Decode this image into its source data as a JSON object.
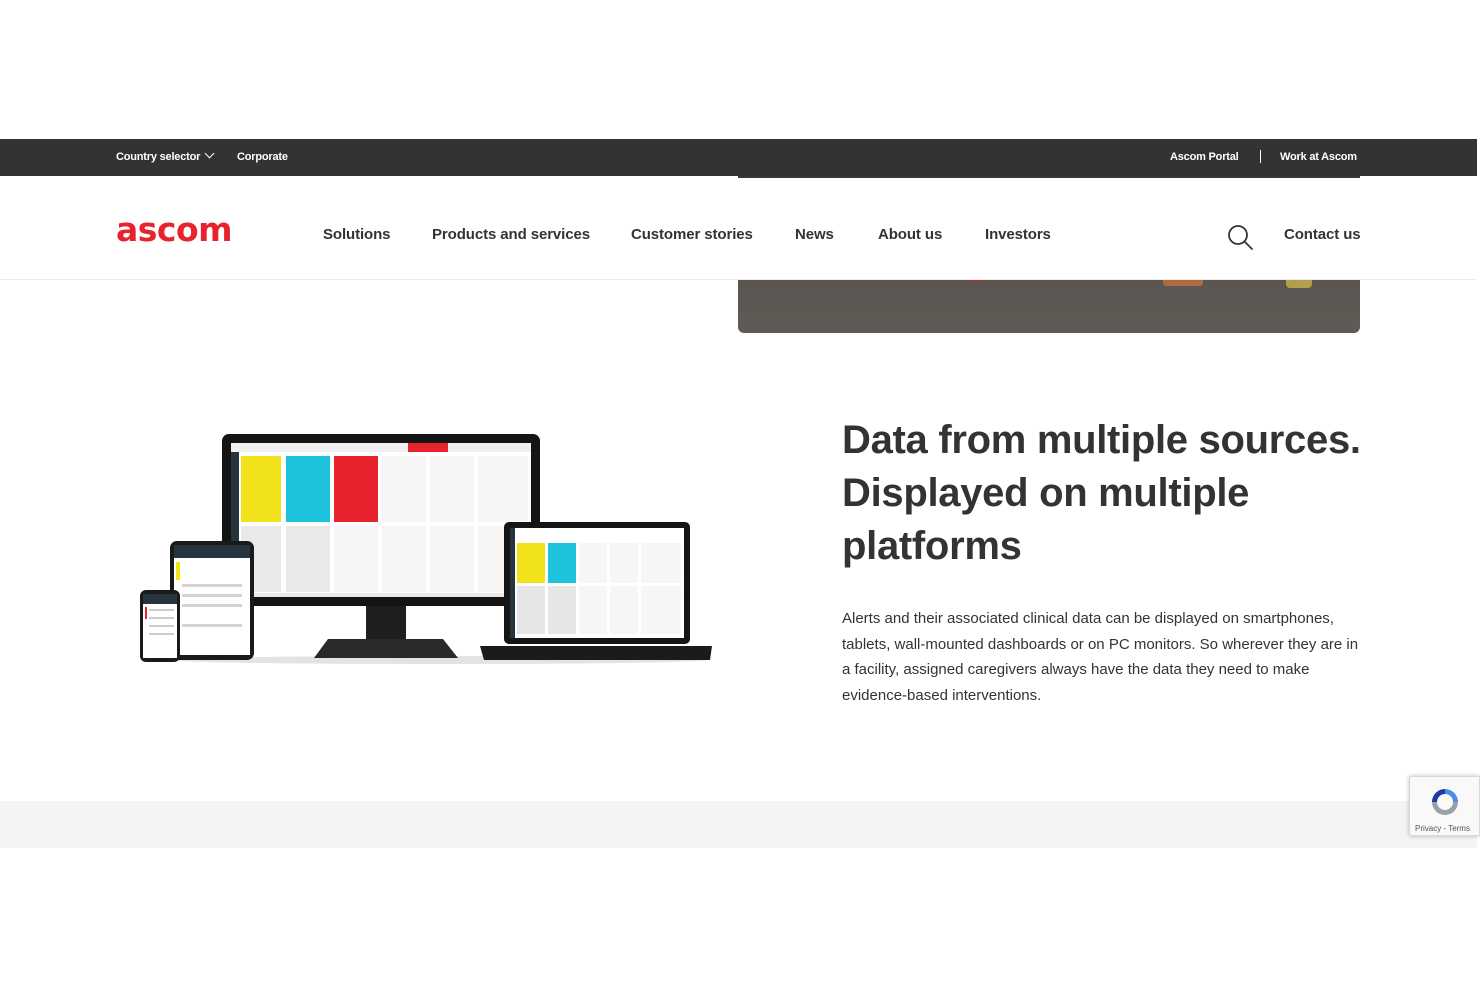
{
  "topbar": {
    "country_selector": "Country selector",
    "corporate": "Corporate",
    "portal": "Ascom Portal",
    "work": "Work at Ascom"
  },
  "brand": {
    "logo_text": "ascom",
    "accent": "#e8232e"
  },
  "nav": {
    "items": [
      "Solutions",
      "Products and services",
      "Customer stories",
      "News",
      "About us",
      "Investors"
    ],
    "contact": "Contact us",
    "search_icon": "search-icon"
  },
  "content": {
    "headline": "Data from multiple sources. Displayed on multiple platforms",
    "body": "Alerts and their associated clinical data can be displayed on smartphones, tablets, wall-mounted dashboards or on PC monitors. So wherever they are in a facility, assigned caregivers always have the data they need to make evidence-based interventions."
  },
  "recaptcha": {
    "terms": "Privacy - Terms"
  }
}
